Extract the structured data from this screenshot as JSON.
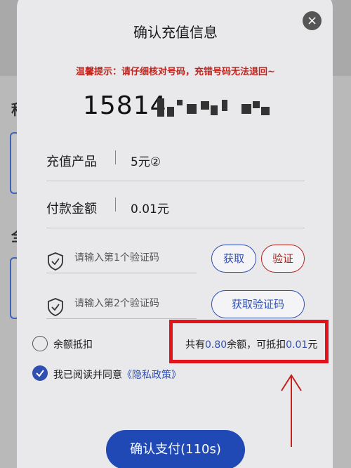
{
  "background": {
    "chars": [
      "积",
      "全"
    ]
  },
  "modal": {
    "title": "确认充值信息",
    "close_symbol": "×",
    "warning": "温馨提示：请仔细核对号码，充错号码无法退回~",
    "phone_prefix": "15814",
    "product": {
      "label": "充值产品",
      "value": "5元②"
    },
    "payment": {
      "label": "付款金额",
      "value": "0.01元"
    },
    "code1": {
      "placeholder": "请输入第1个验证码",
      "get_label": "获取",
      "verify_label": "验证"
    },
    "code2": {
      "placeholder": "请输入第2个验证码",
      "get_label": "获取验证码"
    },
    "balance_option": {
      "label": "余额抵扣",
      "text_1": "共有",
      "total": "0.80",
      "text_2": "余额，可抵扣",
      "deduct": "0.01",
      "text_3": "元"
    },
    "agreement": {
      "text": "我已阅读并同意",
      "link": "《隐私政策》"
    },
    "pay_button": "确认支付(110s)"
  },
  "colors": {
    "accent": "#2f4fb0",
    "warning": "#c0241d",
    "annotation": "#e0141a",
    "pay_button": "#2149b5"
  }
}
